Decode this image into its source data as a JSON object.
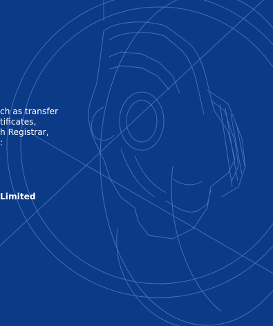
{
  "body_text": {
    "lines": [
      "ch as transfer",
      "tificates,",
      "h Registrar,",
      ":"
    ]
  },
  "company_name": "Limited",
  "colors": {
    "background": "#0b3a86",
    "line_art": "#4a6fb7",
    "text": "#ffffff"
  }
}
